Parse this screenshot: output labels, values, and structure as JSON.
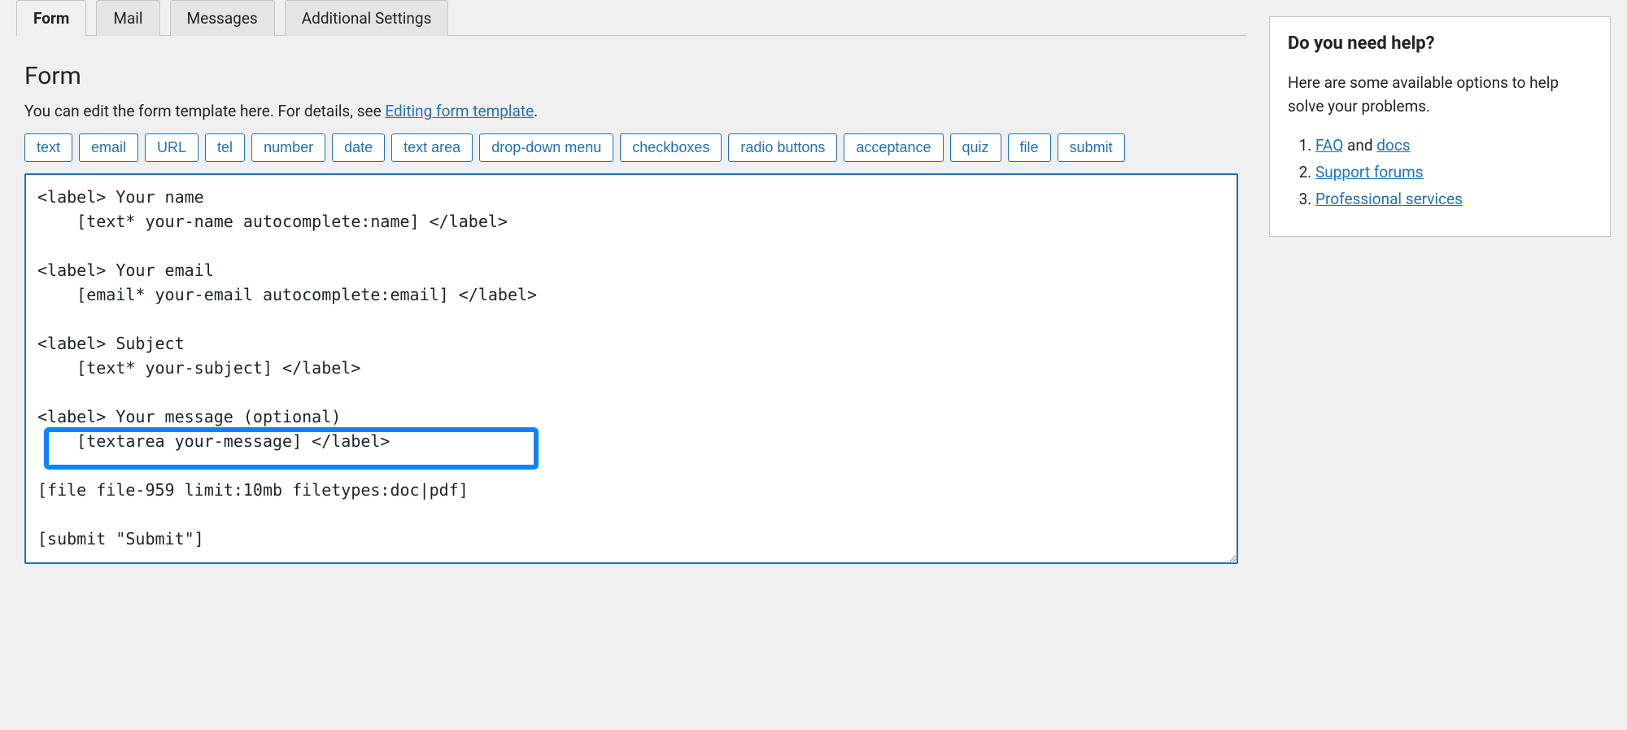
{
  "tabs": {
    "form": "Form",
    "mail": "Mail",
    "messages": "Messages",
    "additional": "Additional Settings"
  },
  "section": {
    "title": "Form",
    "desc_before": "You can edit the form template here. For details, see ",
    "desc_link": "Editing form template",
    "desc_after": "."
  },
  "tag_buttons": {
    "text": "text",
    "email": "email",
    "url": "URL",
    "tel": "tel",
    "number": "number",
    "date": "date",
    "textarea": "text area",
    "dropdown": "drop-down menu",
    "checkboxes": "checkboxes",
    "radio": "radio buttons",
    "acceptance": "acceptance",
    "quiz": "quiz",
    "file": "file",
    "submit": "submit"
  },
  "form_content": "<label> Your name\n    [text* your-name autocomplete:name] </label>\n\n<label> Your email\n    [email* your-email autocomplete:email] </label>\n\n<label> Subject\n    [text* your-subject] </label>\n\n<label> Your message (optional)\n    [textarea your-message] </label>\n\n[file file-959 limit:10mb filetypes:doc|pdf]\n\n[submit \"Submit\"]",
  "help": {
    "title": "Do you need help?",
    "text": "Here are some available options to help solve your problems.",
    "item1_link": "FAQ",
    "item1_mid": " and ",
    "item1_link2": "docs",
    "item2": "Support forums",
    "item3": "Professional services"
  }
}
